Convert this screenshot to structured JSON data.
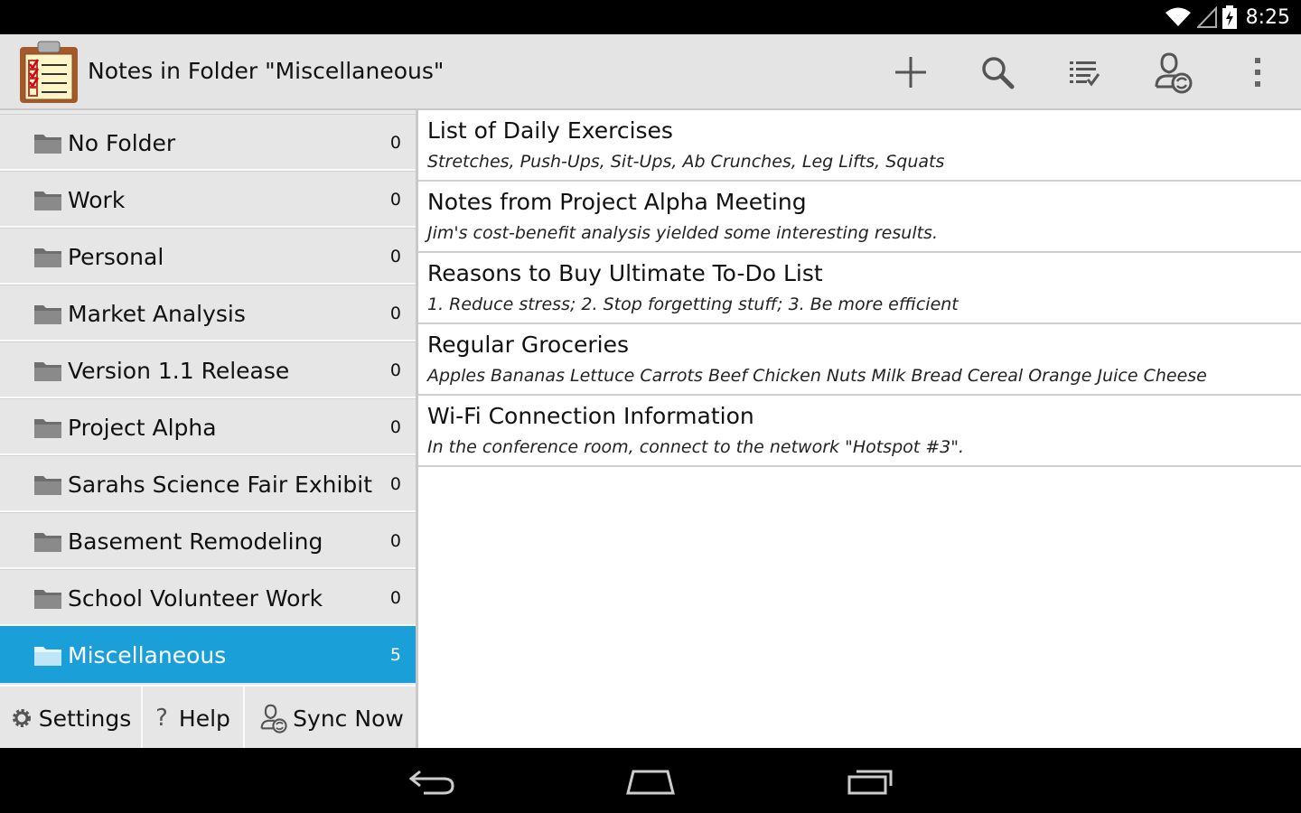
{
  "status_bar": {
    "time": "8:25"
  },
  "action_bar": {
    "title": "Notes in Folder \"Miscellaneous\"",
    "actions": [
      {
        "name": "add-note",
        "icon": "plus-icon"
      },
      {
        "name": "search",
        "icon": "search-icon"
      },
      {
        "name": "view-list",
        "icon": "list-check-icon"
      },
      {
        "name": "sync-account",
        "icon": "sync-user-icon"
      },
      {
        "name": "overflow-menu",
        "icon": "more-vertical-icon"
      }
    ]
  },
  "folders": [
    {
      "name": "No Folder",
      "count": "0"
    },
    {
      "name": "Work",
      "count": "0"
    },
    {
      "name": "Personal",
      "count": "0"
    },
    {
      "name": "Market Analysis",
      "count": "0"
    },
    {
      "name": "Version 1.1 Release",
      "count": "0"
    },
    {
      "name": "Project Alpha",
      "count": "0"
    },
    {
      "name": "Sarahs Science Fair Exhibit",
      "count": "0"
    },
    {
      "name": "Basement Remodeling",
      "count": "0"
    },
    {
      "name": "School Volunteer Work",
      "count": "0"
    },
    {
      "name": "Miscellaneous",
      "count": "5",
      "selected": true
    }
  ],
  "bottom_buttons": {
    "settings": "Settings",
    "help": "Help",
    "sync": "Sync Now"
  },
  "notes": [
    {
      "title": "List of Daily Exercises",
      "preview": "Stretches, Push-Ups, Sit-Ups, Ab Crunches, Leg Lifts, Squats"
    },
    {
      "title": "Notes from Project Alpha Meeting",
      "preview": "Jim's cost-benefit analysis yielded some interesting results."
    },
    {
      "title": "Reasons to Buy Ultimate To-Do List",
      "preview": "1. Reduce stress; 2. Stop forgetting stuff; 3. Be more efficient"
    },
    {
      "title": "Regular Groceries",
      "preview": "Apples Bananas Lettuce Carrots Beef Chicken Nuts Milk Bread Cereal Orange Juice Cheese"
    },
    {
      "title": "Wi-Fi Connection Information",
      "preview": "In the conference room, connect to the network \"Hotspot #3\"."
    }
  ],
  "colors": {
    "selected": "#1b9fd8",
    "action_bar": "#e4e4e4",
    "panel": "#e6e6e6"
  }
}
